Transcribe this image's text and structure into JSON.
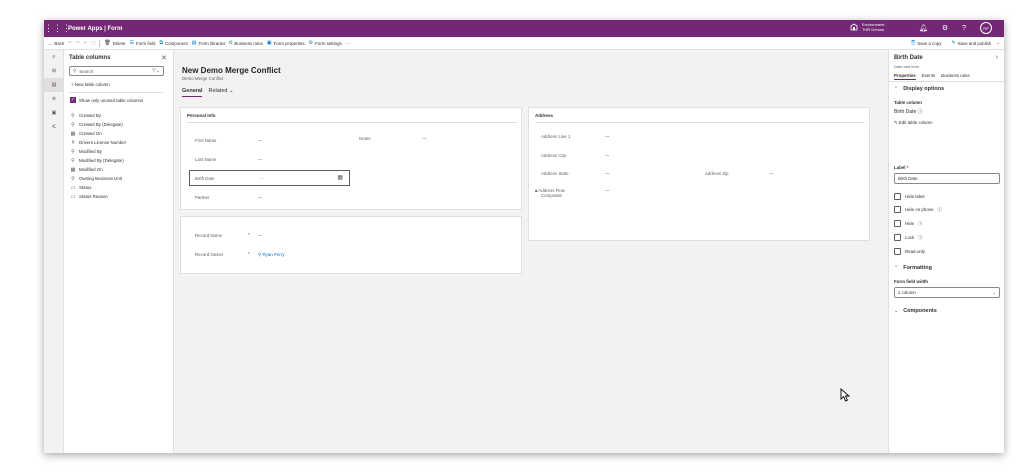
{
  "app": {
    "title": "Power Apps | Form",
    "environment_label": "Environment",
    "environment_name": "THR Demos",
    "avatar_initials": "RP",
    "brand_color": "#742774"
  },
  "commandbar": {
    "back": "Back",
    "delete": "Delete",
    "form_field": "Form field",
    "component": "Component",
    "form_libraries": "Form libraries",
    "business_rules": "Business rules",
    "form_properties": "Form properties",
    "form_settings": "Form settings",
    "more": "···",
    "save_copy": "Save a copy",
    "save_publish": "Save and publish"
  },
  "columns_pane": {
    "title": "Table columns",
    "search_placeholder": "Search",
    "new_column": "+ New table column",
    "show_unused": "Show only unused table columns",
    "items": [
      {
        "icon": "lookup-icon",
        "glyph": "⚲",
        "label": "Created By"
      },
      {
        "icon": "lookup-icon",
        "glyph": "⚲",
        "label": "Created By (Delegate)"
      },
      {
        "icon": "calendar-icon",
        "glyph": "▦",
        "label": "Created On"
      },
      {
        "icon": "number-icon",
        "glyph": "#",
        "label": "Drivers License Number"
      },
      {
        "icon": "lookup-icon",
        "glyph": "⚲",
        "label": "Modified By"
      },
      {
        "icon": "lookup-icon",
        "glyph": "⚲",
        "label": "Modified By (Delegate)"
      },
      {
        "icon": "calendar-icon",
        "glyph": "▦",
        "label": "Modified On"
      },
      {
        "icon": "lookup-icon",
        "glyph": "⚲",
        "label": "Owning Business Unit"
      },
      {
        "icon": "choice-icon",
        "glyph": "▭",
        "label": "Status"
      },
      {
        "icon": "choice-icon",
        "glyph": "▭",
        "label": "Status Reason"
      }
    ]
  },
  "form": {
    "title": "New Demo Merge Conflict",
    "subtitle": "Demo Merge Conflict",
    "tab_general": "General",
    "tab_related": "Related",
    "personal_info": {
      "title": "Personal Info",
      "first_name": "First Name",
      "last_name": "Last Name",
      "birth_date": "Birth Date",
      "partner": "Partner",
      "notes": "Notes",
      "empty": "---"
    },
    "record": {
      "record_name": "Record Name",
      "record_owner": "Record Owner",
      "required": "*",
      "owner_value": "Ryan Perry",
      "empty": "---"
    },
    "address": {
      "title": "Address",
      "line1": "Address Line 1",
      "city": "Address City",
      "state": "Address State",
      "zip": "Address Zip",
      "flow_composite_1": "Address Flow",
      "flow_composite_2": "Composite",
      "empty": "---"
    }
  },
  "properties_pane": {
    "title": "Birth Date",
    "subtitle": "Date and time",
    "tab_properties": "Properties",
    "tab_events": "Events",
    "tab_business_rules": "Business rules",
    "display_options": "Display options",
    "table_column_label": "Table column",
    "table_column_value": "Birth Date",
    "edit_table_column": "Edit table column",
    "label_label": "Label",
    "label_required": "*",
    "label_value": "Birth Date",
    "hide_label": "Hide label",
    "hide_on_phone": "Hide on phone",
    "hide": "Hide",
    "lock": "Lock",
    "read_only": "Read-only",
    "formatting": "Formatting",
    "form_field_width": "Form field width",
    "width_value": "1 column",
    "components": "Components"
  }
}
